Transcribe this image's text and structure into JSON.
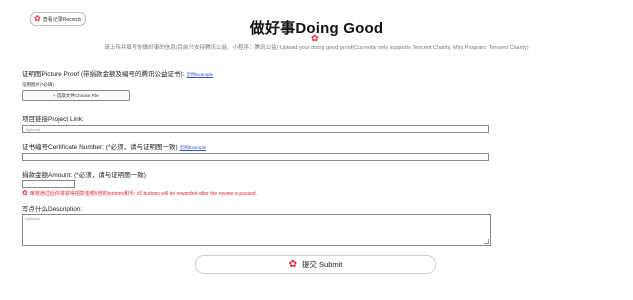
{
  "header": {
    "records_button": "查看记录Records",
    "title": "做好事Doing Good",
    "subtitle": "请上传并填写你做好事的信息(目前只支持腾讯公益、小程序：腾讯公益) Upload your doing good proof(Currently only supports Tencent Charity, Mini Program: Tencent Charity)"
  },
  "picture_proof": {
    "label": "证明图Picture Proof (带捐款金额及编号的腾讯公益证书):",
    "example_link": "示例Example",
    "sub_label": "证明图片(*必填)",
    "choose_file": "+ 选取文件Choose File"
  },
  "project_link": {
    "label": "项目链接Project Link:",
    "placeholder": "Optional"
  },
  "certificate": {
    "label": "证书编号Certificate Number: (*必须，请与证明图一致)",
    "example_link": "示例Example",
    "value": ""
  },
  "amount": {
    "label": "捐款金额Amount: (*必须，请与证明图一致)",
    "value": "",
    "reward_note": "审核通过后你将获得捐款金额5倍的buttons和币; x5 buttons will be rewarded after the review is passed."
  },
  "description": {
    "label": "写点什么Description:",
    "placeholder": "Optional"
  },
  "submit_button": "提交 Submit",
  "colors": {
    "accent": "#e0263a",
    "link": "#3355cc"
  },
  "icons": {
    "flower": "flower-icon"
  }
}
